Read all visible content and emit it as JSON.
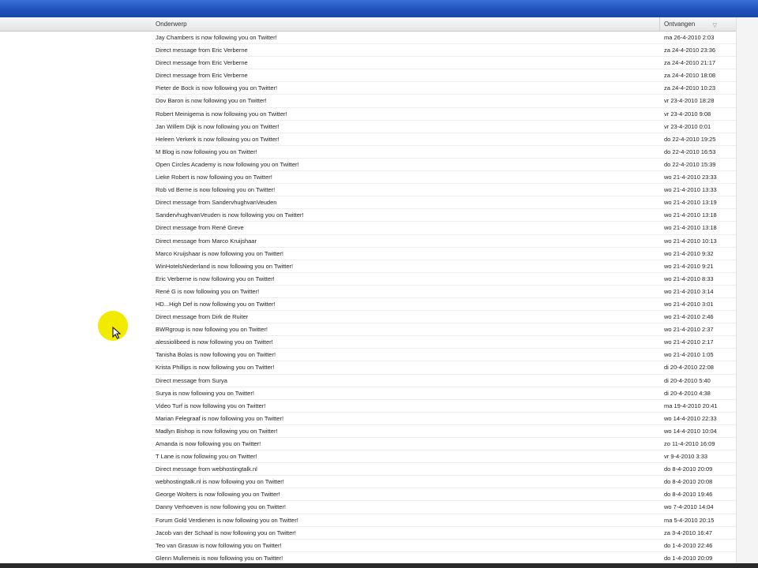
{
  "header": {
    "subject_label": "Onderwerp",
    "received_label": "Ontvangen"
  },
  "rows": [
    {
      "subject": "Jay Chambers is now following you on Twitter!",
      "date": "ma 26-4-2010 2:03"
    },
    {
      "subject": "Direct message from Eric Verberne",
      "date": "za 24-4-2010 23:36"
    },
    {
      "subject": "Direct message from Eric Verberne",
      "date": "za 24-4-2010 21:17"
    },
    {
      "subject": "Direct message from Eric Verberne",
      "date": "za 24-4-2010 18:08"
    },
    {
      "subject": "Pieter de Bock is now following you on Twitter!",
      "date": "za 24-4-2010 10:23"
    },
    {
      "subject": "Dov Baron is now following you on Twitter!",
      "date": "vr 23-4-2010 18:28"
    },
    {
      "subject": "Robert Meinigema is now following you on Twitter!",
      "date": "vr 23-4-2010 9:08"
    },
    {
      "subject": "Jan Willem Dijk is now following you on Twitter!",
      "date": "vr 23-4-2010 0:01"
    },
    {
      "subject": "Heleen Verkerk is now following you on Twitter!",
      "date": "do 22-4-2010 19:25"
    },
    {
      "subject": "M Blog is now following you on Twitter!",
      "date": "do 22-4-2010 16:53"
    },
    {
      "subject": "Open Circles Academy is now following you on Twitter!",
      "date": "do 22-4-2010 15:39"
    },
    {
      "subject": "Lieke Robert is now following you on Twitter!",
      "date": "wo 21-4-2010 23:33"
    },
    {
      "subject": "Rob vd Berne is now following you on Twitter!",
      "date": "wo 21-4-2010 13:33"
    },
    {
      "subject": "Direct message from SandervhughvanVeuden",
      "date": "wo 21-4-2010 13:19"
    },
    {
      "subject": "SandervhughvanVeuden is now following you on Twitter!",
      "date": "wo 21-4-2010 13:18"
    },
    {
      "subject": "Direct message from René Greve",
      "date": "wo 21-4-2010 13:18"
    },
    {
      "subject": "Direct message from Marco Kruijshaar",
      "date": "wo 21-4-2010 10:13"
    },
    {
      "subject": "Marco Kruijshaar is now following you on Twitter!",
      "date": "wo 21-4-2010 9:32"
    },
    {
      "subject": "WinHotelsNederland is now following you on Twitter!",
      "date": "wo 21-4-2010 9:21"
    },
    {
      "subject": "Eric Verberne is now following you on Twitter!",
      "date": "wo 21-4-2010 8:33"
    },
    {
      "subject": "René G is now following you on Twitter!",
      "date": "wo 21-4-2010 3:14"
    },
    {
      "subject": "HD...High Def is now following you on Twitter!",
      "date": "wo 21-4-2010 3:01"
    },
    {
      "subject": "Direct message from Dirk de Ruiter",
      "date": "wo 21-4-2010 2:46"
    },
    {
      "subject": "BWRgroup is now following you on Twitter!",
      "date": "wo 21-4-2010 2:37"
    },
    {
      "subject": "alessiolibeed is now following you on Twitter!",
      "date": "wo 21-4-2010 2:17"
    },
    {
      "subject": "Tanisha Bolas is now following you on Twitter!",
      "date": "wo 21-4-2010 1:05"
    },
    {
      "subject": "Krista Phillips is now following you on Twitter!",
      "date": "di 20-4-2010 22:08"
    },
    {
      "subject": "Direct message from Surya",
      "date": "di 20-4-2010 5:40"
    },
    {
      "subject": "Surya is now following you on Twitter!",
      "date": "di 20-4-2010 4:38"
    },
    {
      "subject": "Video Turf is now following you on Twitter!",
      "date": "ma 19-4-2010 20:41"
    },
    {
      "subject": "Marian Felegraaf is now following you on Twitter!",
      "date": "wo 14-4-2010 22:33"
    },
    {
      "subject": "Madlyn Bishop is now following you on Twitter!",
      "date": "wo 14-4-2010 10:04"
    },
    {
      "subject": "Amanda is now following you on Twitter!",
      "date": "zo 11-4-2010 16:09"
    },
    {
      "subject": "T Lane is now following you on Twitter!",
      "date": "vr 9-4-2010 3:33"
    },
    {
      "subject": "Direct message from webhostingtalk.nl",
      "date": "do 8-4-2010 20:09"
    },
    {
      "subject": "webhostingtalk.nl is now following you on Twitter!",
      "date": "do 8-4-2010 20:08"
    },
    {
      "subject": "George Wolters is now following you on Twitter!",
      "date": "do 8-4-2010 19:46"
    },
    {
      "subject": "Danny Verhoeven is now following you on Twitter!",
      "date": "wo 7-4-2010 14:04"
    },
    {
      "subject": "Forum Gold Verdienen is now following you on Twitter!",
      "date": "ma 5-4-2010 20:15"
    },
    {
      "subject": "Jacob van der Schaaf is now following you on Twitter!",
      "date": "za 3-4-2010 16:47"
    },
    {
      "subject": "Teo van Grasuw is now following you on Twitter!",
      "date": "do 1-4-2010 22:46"
    },
    {
      "subject": "Glenn Mullemeis is now following you on Twitter!",
      "date": "do 1-4-2010 20:09"
    }
  ],
  "colors": {
    "titlebar": "#1f4fb8",
    "cursor_highlight": "#f2ea00"
  }
}
